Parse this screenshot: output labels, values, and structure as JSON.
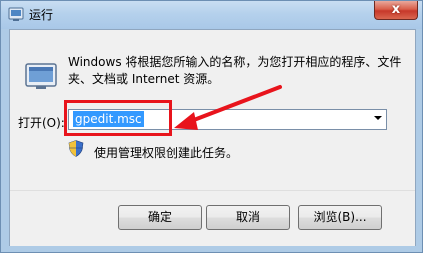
{
  "window": {
    "title": "运行",
    "close_label": "x"
  },
  "dialog": {
    "description": "Windows 将根据您所输入的名称，为您打开相应的程序、文件夹、文档或 Internet 资源。",
    "open_label": "打开(O):",
    "open_value": "gpedit.msc",
    "admin_note": "使用管理权限创建此任务。"
  },
  "buttons": {
    "ok": "确定",
    "cancel": "取消",
    "browse": "浏览(B)..."
  },
  "annotation": {
    "highlight_color": "#e8141c"
  },
  "icons": {
    "app": "run-icon",
    "shield": "uac-shield-icon",
    "dropdown": "chevron-down-icon",
    "annotation_arrow": "arrow-icon"
  }
}
